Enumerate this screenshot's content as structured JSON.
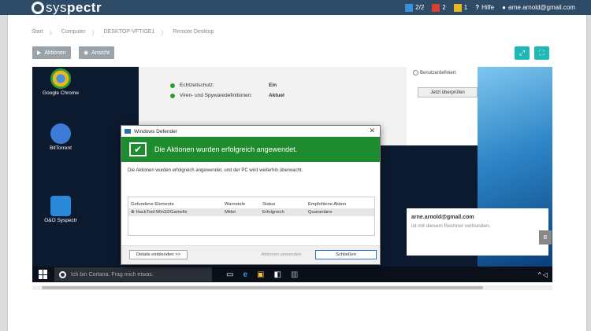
{
  "header": {
    "logo_text_prefix": "sys",
    "logo_text_suffix": "pectr",
    "counts": [
      {
        "label": "2/2",
        "color": "#3a8fd9"
      },
      {
        "label": "2",
        "color": "#d9412f"
      },
      {
        "label": "1",
        "color": "#e8b822"
      }
    ],
    "help_label": "Hilfe",
    "user_email": "arne.arnold@gmail.com"
  },
  "breadcrumb": [
    "Start",
    "Computer",
    "DESKTOP-VFTIGE1",
    "Remote Desktop"
  ],
  "toolbar": {
    "actions_label": "Aktionen",
    "view_label": "Ansicht"
  },
  "desktop": {
    "icons": [
      {
        "label": "Google Chrome"
      },
      {
        "label": "BitTorrent"
      },
      {
        "label": "O&O Syspectr"
      }
    ],
    "status_rows": [
      {
        "label": "Echtzeitschutz:",
        "value": "Ein"
      },
      {
        "label": "Viren- und Spywaredefinitionen:",
        "value": "Aktuel"
      }
    ],
    "radio_label": "Benutzerdefiniert",
    "scan_button": "Jetzt überprüfen",
    "account_email": "arne.arnold@gmail.com",
    "account_text": "ist mit diesem Rechner verbunden.",
    "account_button": "B",
    "taskbar": {
      "cortana_placeholder": "Ich bin Cortana. Frag mich etwas.",
      "tray": "^ ◁"
    }
  },
  "defender": {
    "title": "Windows Defender",
    "banner": "Die Aktionen wurden erfolgreich angewendet.",
    "message": "Die Aktionen wurden erfolgreich angewendet, und der PC wird weiterhin überwacht.",
    "table": {
      "headers": [
        "Gefundene Elemente",
        "Warnstufe",
        "Status",
        "Empfohlene Aktion"
      ],
      "rows": [
        [
          "⊕ HackTool:Win32/Gamefix",
          "Mittel",
          "Erfolgreich",
          "Quarantäne"
        ]
      ]
    },
    "details_button": "Details einblenden >>",
    "apply_button": "Aktionen anwenden",
    "close_button": "Schließen"
  }
}
